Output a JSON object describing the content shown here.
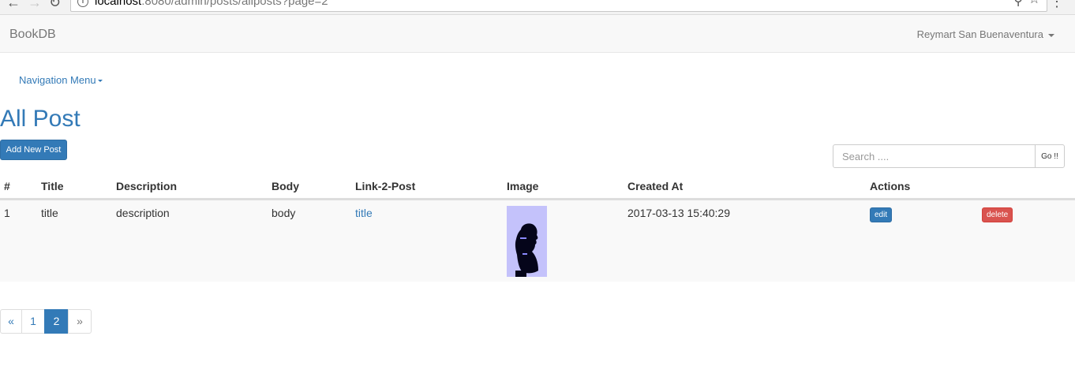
{
  "browser": {
    "url_host": "localhost",
    "url_rest": ":8080/admin/posts/allposts?page=2"
  },
  "navbar": {
    "brand": "BookDB",
    "user": "Reymart San Buenaventura"
  },
  "nav_menu_label": "Navigation Menu",
  "page_title": "All Post",
  "add_button_label": "Add New Post",
  "search": {
    "placeholder": "Search ....",
    "button_label": "Go !!"
  },
  "table": {
    "headers": [
      "#",
      "Title",
      "Description",
      "Body",
      "Link-2-Post",
      "Image",
      "Created At",
      "Actions"
    ],
    "rows": [
      {
        "id": "1",
        "title": "title",
        "description": "description",
        "body": "body",
        "link": "title",
        "created_at": "2017-03-13 15:40:29",
        "edit_label": "edit",
        "delete_label": "delete"
      }
    ]
  },
  "pagination": {
    "prev": "«",
    "pages": [
      "1",
      "2"
    ],
    "current": "2",
    "next": "»"
  },
  "colors": {
    "primary": "#337ab7",
    "danger": "#d9534f",
    "thumbnail_bg": "#c4c2fb"
  }
}
